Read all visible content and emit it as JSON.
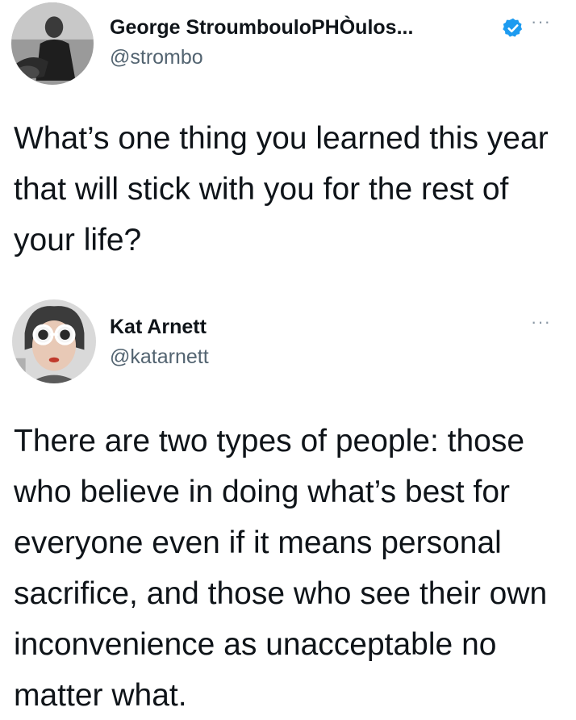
{
  "tweets": [
    {
      "display_name": "George StroumbouloPHÒulos...",
      "handle": "@strombo",
      "verified_icon": "verified-badge-icon",
      "more_label": "···",
      "text": "What’s one thing you learned this year that will stick with you for the rest of your life?"
    },
    {
      "display_name": "Kat Arnett",
      "handle": "@katarnett",
      "more_label": "···",
      "text": "There are two types of people: those who believe in doing what’s best for everyone even if it means personal sacrifice, and those who see their own inconvenience as unacceptable no matter what."
    }
  ],
  "colors": {
    "text": "#0f1419",
    "secondary": "#536471",
    "verified": "#1d9bf0"
  }
}
